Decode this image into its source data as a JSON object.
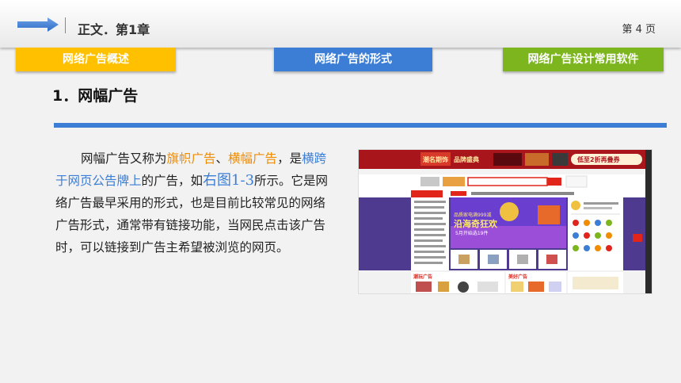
{
  "header": {
    "chapter": "正文．第1章",
    "page": "第 4 页"
  },
  "tabs": [
    {
      "label": "网络广告概述",
      "color": "#ffc000"
    },
    {
      "label": "网络广告的形式",
      "color": "#3c7ed6"
    },
    {
      "label": "网络广告设计常用软件",
      "color": "#7cb51d"
    }
  ],
  "section": {
    "title": "1．网幅广告"
  },
  "body": {
    "p1": "网幅广告又称为",
    "h1": "旗帜广告",
    "p2": "、",
    "h2": "横幅广告",
    "p3": "，是",
    "h3": "横跨于网页公告牌上",
    "p4": "的广告，如",
    "ref": "右图1-3",
    "p5": "所示。它是网络广告最早采用的形式，也是目前比较常见的网络广告形式，通常带有链接功能，当网民点击该广告时，可以链接到广告主希望被浏览的网页。"
  },
  "screenshot": {
    "banner_brand": "潮名期饰",
    "banner_mid": "品牌盛典",
    "banner_right": "低至2折再叠券",
    "hero_line1": "品质家电满999减",
    "hero_line2": "沿海奇狂欢",
    "hero_line3": "5月开始选19件",
    "floor1": "潮玩广告",
    "floor2": "美好广告"
  }
}
